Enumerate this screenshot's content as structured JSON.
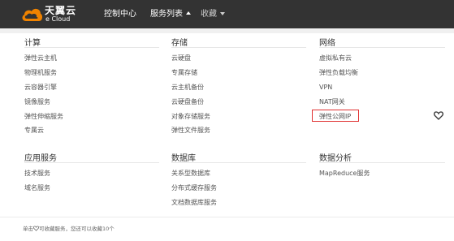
{
  "header": {
    "brand_cn": "天翼云",
    "brand_en": "e Cloud",
    "nav": [
      {
        "label": "控制中心"
      },
      {
        "label": "服务列表"
      },
      {
        "label": "收藏"
      }
    ]
  },
  "columns": [
    {
      "title": "计算",
      "items": [
        "弹性云主机",
        "物理机服务",
        "云容器引擎",
        "镜像服务",
        "弹性伸缩服务",
        "专属云"
      ]
    },
    {
      "title": "存储",
      "items": [
        "云硬盘",
        "专属存储",
        "云主机备份",
        "云硬盘备份",
        "对象存储服务",
        "弹性文件服务"
      ]
    },
    {
      "title": "网络",
      "items": [
        "虚拟私有云",
        "弹性负载均衡",
        "VPN",
        "NAT网关",
        "弹性公网IP"
      ]
    },
    {
      "title": "应用服务",
      "items": [
        "技术服务",
        "域名服务"
      ]
    },
    {
      "title": "数据库",
      "items": [
        "关系型数据库",
        "分布式缓存服务",
        "文档数据库服务"
      ]
    },
    {
      "title": "数据分析",
      "items": [
        "MapReduce服务"
      ]
    }
  ],
  "highlighted_item": "弹性公网IP",
  "footer": {
    "pre": "单击",
    "post": "可收藏服务，您还可以收藏10个"
  },
  "colors": {
    "topbar": "#333333",
    "logo_orange": "#f08300",
    "highlight_border": "#e03131"
  },
  "icons": {
    "logo": "cloud-logo-icon",
    "favorite": "heart-icon",
    "dropdown_open": "caret-up-icon",
    "dropdown_closed": "caret-down-icon"
  }
}
